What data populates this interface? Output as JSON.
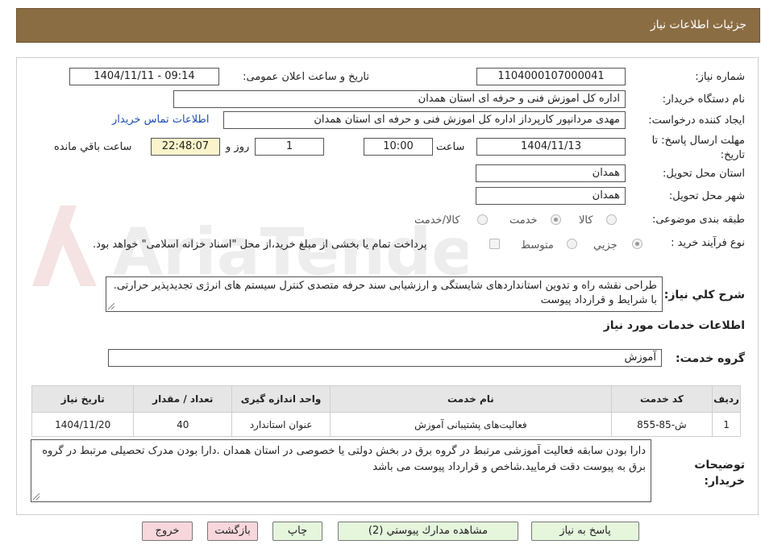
{
  "header": {
    "title": "جزئیات اطلاعات نیاز"
  },
  "fields": {
    "need_number": {
      "label": "شماره نیاز:",
      "value": "1104000107000041"
    },
    "announce": {
      "label": "تاریخ و ساعت اعلان عمومی:",
      "value": "1404/11/11 - 09:14"
    },
    "buyer_org": {
      "label": "نام دستگاه خریدار:",
      "value": "اداره کل اموزش فنی و حرفه ای استان همدان"
    },
    "requester": {
      "label": "ایجاد کننده درخواست:",
      "value": "مهدی مردانپور کارپرداز اداره کل اموزش فنی و حرفه ای استان همدان",
      "link": "اطلاعات تماس خریدار"
    },
    "deadline": {
      "label": "مهلت ارسال پاسخ: تا تاریخ:",
      "date": "1404/11/13",
      "time_label": "ساعت",
      "time": "10:00",
      "days": "1",
      "days_label": "روز و",
      "remaining": "22:48:07",
      "remaining_label": "ساعت باقي مانده"
    },
    "province": {
      "label": "استان محل تحویل:",
      "value": "همدان"
    },
    "city": {
      "label": "شهر محل تحویل:",
      "value": "همدان"
    },
    "category": {
      "label": "طبقه بندی موضوعی:",
      "options": [
        "کالا",
        "خدمت",
        "کالا/خدمت"
      ],
      "selected": "خدمت"
    },
    "process": {
      "label": "نوع فرآیند خرید :",
      "options": [
        "جزيي",
        "متوسط"
      ],
      "selected": "جزيي",
      "note": "پرداخت تمام یا بخشی از مبلغ خرید،از محل \"اسناد خزانه اسلامی\" خواهد بود."
    }
  },
  "description": {
    "label": "شرح كلي نياز:",
    "text": "طراحی نقشه راه و تدوین استانداردهای شایستگی و ارزشیابی سند حرفه متصدی کنترل سیستم های انرژی تجدیدپذیر حرارتی. با شرایط و قرارداد پیوست"
  },
  "services": {
    "section_title": "اطلاعات خدمات مورد نياز",
    "group_label": "گروه خدمت:",
    "group_value": "آموزش",
    "columns": [
      "ردیف",
      "کد خدمت",
      "نام خدمت",
      "واحد اندازه گیری",
      "تعداد / مقدار",
      "تاریخ نیاز"
    ],
    "rows": [
      [
        "1",
        "ش-85-855",
        "فعالیت‌های پشتیبانی آموزش",
        "عنوان استاندارد",
        "40",
        "1404/11/20"
      ]
    ]
  },
  "buyer_notes": {
    "label": "توضیحات خریدار:",
    "text": "دارا بودن سابقه فعالیت آموزشی مرتبط در گروه برق در بخش دولتی یا خصوصی در استان همدان .دارا بودن مدرک تحصیلی مرتبط در گروه برق به پیوست دقت فرمایید.شاخص و قرارداد پیوست می باشد"
  },
  "buttons": {
    "reply": "پاسخ به نیاز",
    "docs": "مشاهده مدارك پيوستي (2)",
    "print": "چاپ",
    "back": "بازگشت",
    "exit": "خروج"
  },
  "watermark": {
    "text": "AriaTender.neT"
  },
  "colors": {
    "header_bg": "#8b6d44",
    "remaining_bg": "#fbf4cb",
    "link": "#1d4fb0",
    "btn_green": "#e5f6dd",
    "btn_pink": "#f8d7dc"
  }
}
